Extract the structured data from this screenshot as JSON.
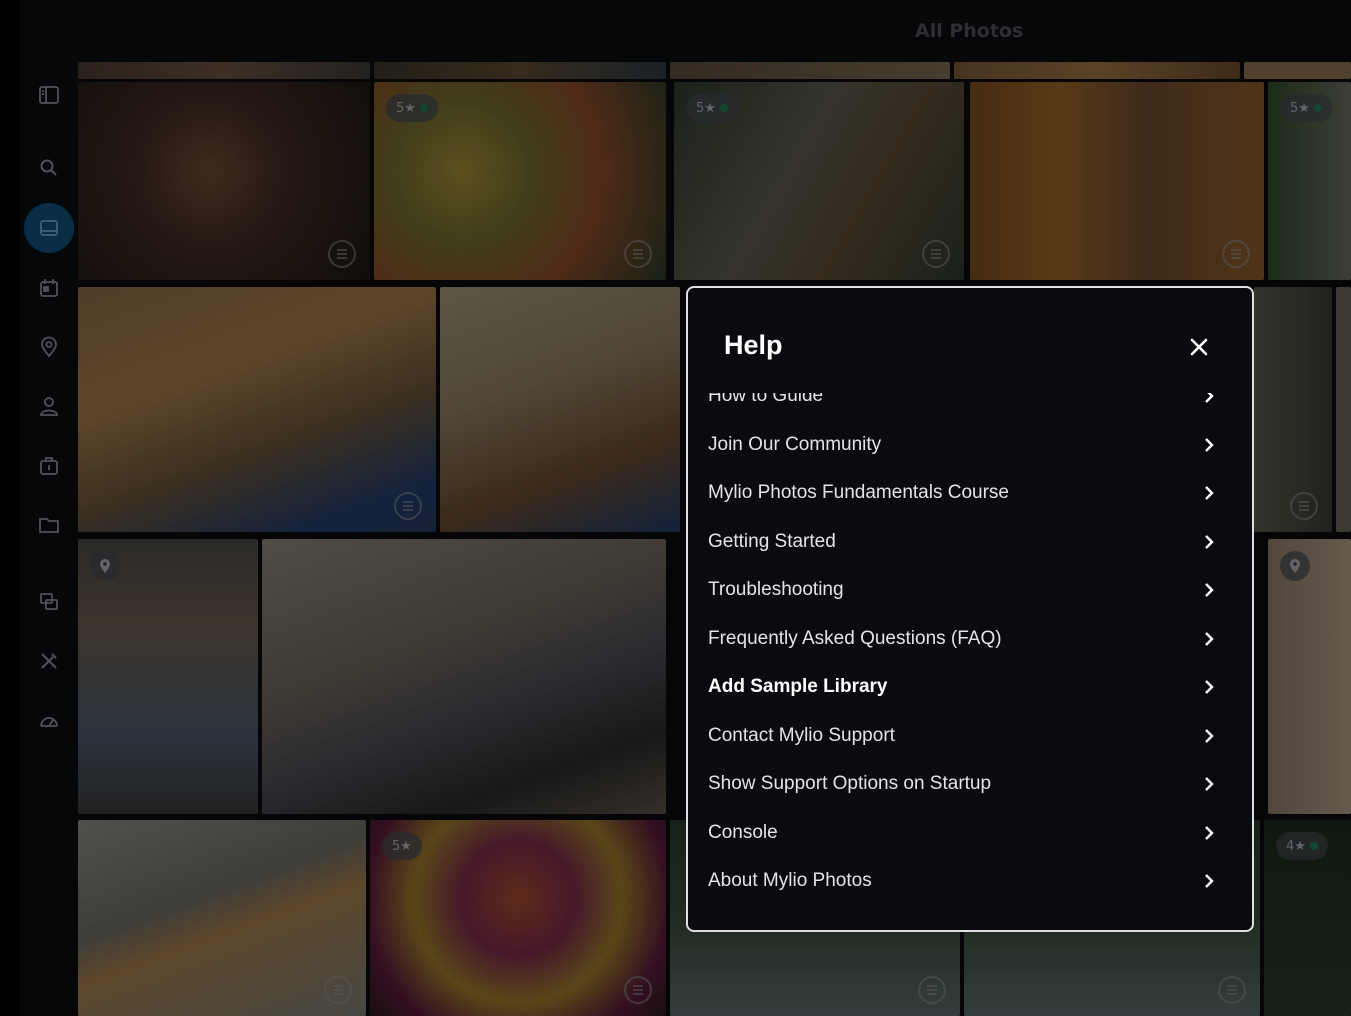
{
  "window": {
    "title": "All Photos"
  },
  "sidebar": {
    "items": [
      {
        "name": "sidebar-toggle-icon"
      },
      {
        "name": "search-icon"
      },
      {
        "name": "photos-icon",
        "active": true
      },
      {
        "name": "calendar-icon"
      },
      {
        "name": "map-pin-icon"
      },
      {
        "name": "people-icon"
      },
      {
        "name": "devices-icon"
      },
      {
        "name": "folder-icon"
      },
      {
        "name": "albums-icon"
      },
      {
        "name": "tools-icon"
      },
      {
        "name": "dashboard-icon"
      }
    ]
  },
  "photos": {
    "badges": {
      "b1": "5★",
      "b2": "5★",
      "b3": "5★",
      "b4": "5★",
      "b5": "4★"
    }
  },
  "help": {
    "title": "Help",
    "items": [
      {
        "label": "How to Guide"
      },
      {
        "label": "Join Our Community"
      },
      {
        "label": "Mylio Photos Fundamentals Course"
      },
      {
        "label": "Getting Started"
      },
      {
        "label": "Troubleshooting"
      },
      {
        "label": "Frequently Asked Questions (FAQ)"
      },
      {
        "label": "Add Sample Library"
      },
      {
        "label": "Contact Mylio Support"
      },
      {
        "label": "Show Support Options on Startup"
      },
      {
        "label": "Console"
      },
      {
        "label": "About Mylio Photos"
      }
    ]
  },
  "colors": {
    "accent": "#0f4e78",
    "background": "#0b0c10",
    "dialog_border": "#dfe0e3"
  }
}
